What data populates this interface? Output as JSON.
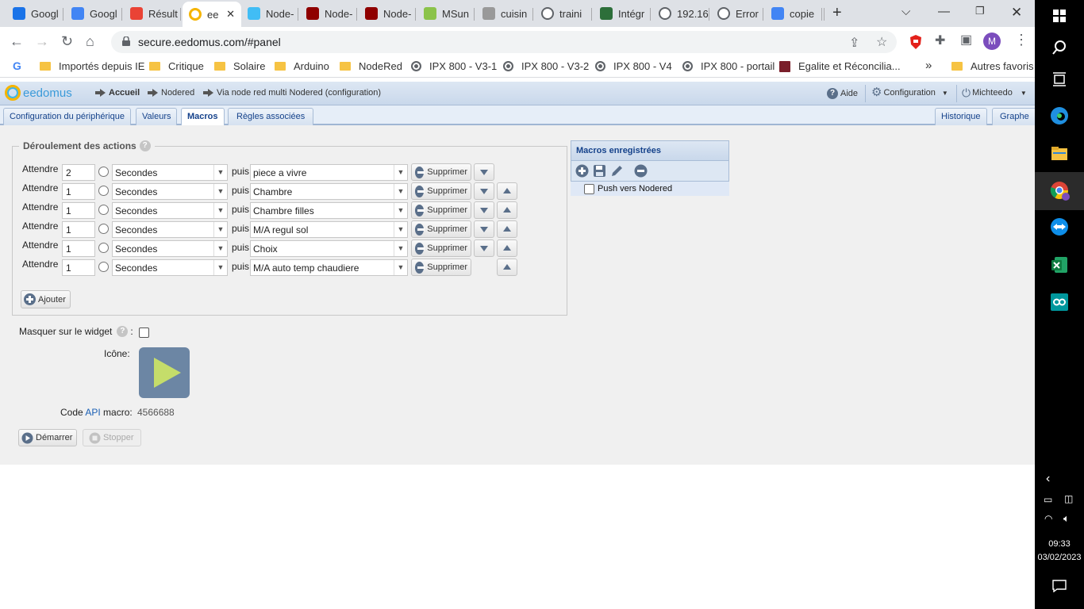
{
  "browser": {
    "tabs": [
      {
        "label": "Googl",
        "icon": "person-icon",
        "color": "#1a73e8"
      },
      {
        "label": "Googl",
        "icon": "calendar-icon",
        "color": "#4285f4"
      },
      {
        "label": "Résult",
        "icon": "gmail-icon",
        "color": "#ea4335"
      },
      {
        "label": "ee",
        "icon": "eedomus-icon",
        "color": "#f5b400",
        "active": true
      },
      {
        "label": "Node-",
        "icon": "home-assistant-icon",
        "color": "#41bdf5"
      },
      {
        "label": "Node-",
        "icon": "nodered-icon",
        "color": "#8f0000"
      },
      {
        "label": "Node-",
        "icon": "nodered-icon",
        "color": "#8f0000"
      },
      {
        "label": "MSun",
        "icon": "msunpv-icon",
        "color": "#8bc34a"
      },
      {
        "label": "cuisin",
        "icon": "kitchen-icon",
        "color": "#999999"
      },
      {
        "label": "traini",
        "icon": "globe-icon",
        "color": "#5f6368"
      },
      {
        "label": "Intégr",
        "icon": "q-icon",
        "color": "#2d6f3a"
      },
      {
        "label": "192.16",
        "icon": "globe-icon",
        "color": "#5f6368"
      },
      {
        "label": "Error",
        "icon": "globe-icon",
        "color": "#5f6368"
      },
      {
        "label": "copie",
        "icon": "google-icon",
        "color": "#4285f4"
      }
    ],
    "url": "secure.eedomus.com/#panel",
    "bookmarks": [
      {
        "label": "Importés depuis IE",
        "type": "folder"
      },
      {
        "label": "Critique",
        "type": "folder"
      },
      {
        "label": "Solaire",
        "type": "folder"
      },
      {
        "label": "Arduino",
        "type": "folder"
      },
      {
        "label": "NodeRed",
        "type": "folder"
      },
      {
        "label": "IPX 800 - V3-1",
        "type": "globe"
      },
      {
        "label": "IPX 800 - V3-2",
        "type": "globe"
      },
      {
        "label": "IPX 800 - V4",
        "type": "globe"
      },
      {
        "label": "IPX 800 - portail",
        "type": "globe"
      },
      {
        "label": "Egalite et Réconcilia...",
        "type": "site"
      }
    ],
    "more_bookmarks": "»",
    "other_favorites": "Autres favoris",
    "profile_initial": "M"
  },
  "app": {
    "logo": "eedomus",
    "breadcrumb": [
      "Accueil",
      "Nodered",
      "Via node red multi Nodered (configuration)"
    ],
    "header_buttons": {
      "help": "Aide",
      "config": "Configuration",
      "user": "Michteedo"
    },
    "tabs": [
      "Configuration du périphérique",
      "Valeurs",
      "Macros",
      "Règles associées"
    ],
    "active_tab": "Macros",
    "right_tabs": [
      "Historique",
      "Graphe"
    ]
  },
  "actions": {
    "legend": "Déroulement des actions",
    "wait_label": "Attendre",
    "then_label": "puis",
    "delete_label": "Supprimer",
    "rows": [
      {
        "value": "2",
        "unit": "Secondes",
        "target": "piece a vivre"
      },
      {
        "value": "1",
        "unit": "Secondes",
        "target": "Chambre"
      },
      {
        "value": "1",
        "unit": "Secondes",
        "target": "Chambre filles"
      },
      {
        "value": "1",
        "unit": "Secondes",
        "target": "M/A regul sol"
      },
      {
        "value": "1",
        "unit": "Secondes",
        "target": "Choix"
      },
      {
        "value": "1",
        "unit": "Secondes",
        "target": "M/A auto temp chaudiere"
      }
    ],
    "add_label": "Ajouter"
  },
  "macros": {
    "title": "Macros enregistrées",
    "items": [
      "Push vers Nodered"
    ]
  },
  "form": {
    "hide_widget_label": "Masquer sur le widget",
    "hide_widget_colon": ":",
    "icon_label": "Icône:",
    "api_code_label_pre": "Code",
    "api_code_link": "API",
    "api_code_label_post": "macro:",
    "api_code_value": "4566688",
    "start_label": "Démarrer",
    "stop_label": "Stopper"
  },
  "taskbar": {
    "time": "09:33",
    "date": "03/02/2023"
  }
}
